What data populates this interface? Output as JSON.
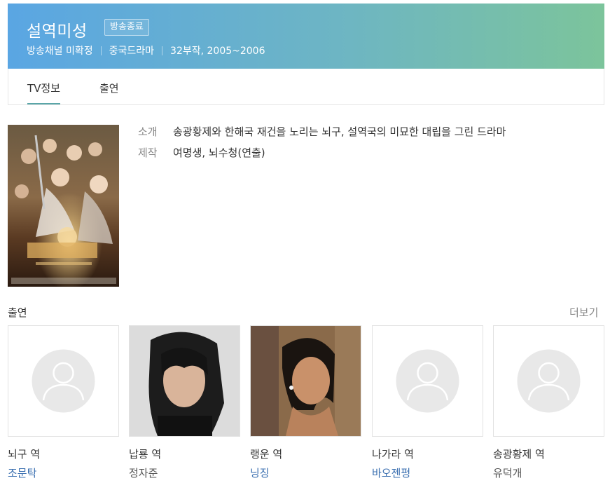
{
  "header": {
    "title": "설역미성",
    "status_badge": "방송종료",
    "channel": "방송채널 미확정",
    "genre": "중국드라마",
    "episodes_year": "32부작, 2005~2006"
  },
  "tabs": [
    {
      "label": "TV정보",
      "active": true
    },
    {
      "label": "출연",
      "active": false
    }
  ],
  "info": {
    "intro_key": "소개",
    "intro_value": "송광황제와 한해국 재건을 노리는 뇌구, 설역국의 미묘한 대립을 그린 드라마",
    "staff_key": "제작",
    "staff_value": "여명생, 뇌수청(연출)"
  },
  "cast_section": {
    "title": "출연",
    "more_label": "더보기",
    "members": [
      {
        "role": "뇌구 역",
        "actor": "조문탁",
        "actor_color": "#3a6fb0",
        "photo": "placeholder"
      },
      {
        "role": "납룡 역",
        "actor": "정자준",
        "actor_color": "#555555",
        "photo": "man"
      },
      {
        "role": "랭운 역",
        "actor": "닝징",
        "actor_color": "#3a6fb0",
        "photo": "woman"
      },
      {
        "role": "나가라 역",
        "actor": "바오젠펑",
        "actor_color": "#3a6fb0",
        "photo": "placeholder"
      },
      {
        "role": "송광황제 역",
        "actor": "유덕개",
        "actor_color": "#555555",
        "photo": "placeholder"
      }
    ]
  }
}
